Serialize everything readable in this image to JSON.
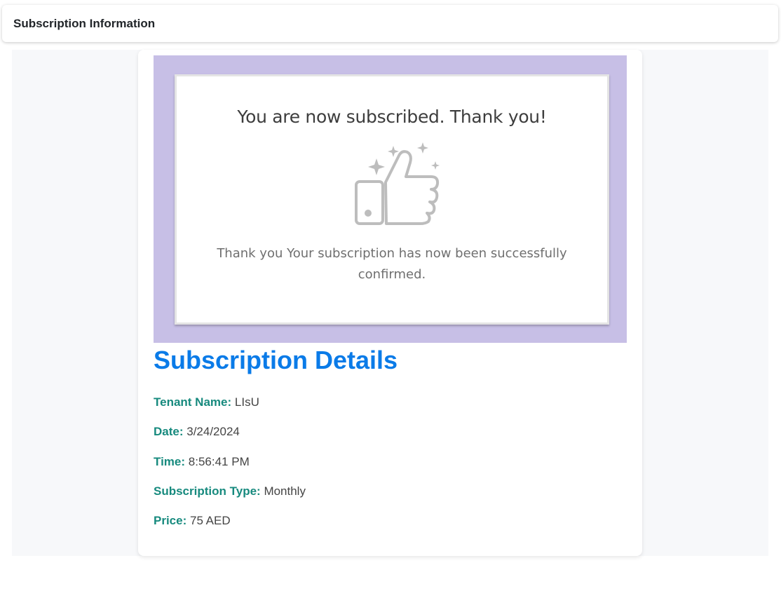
{
  "header": {
    "title": "Subscription Information"
  },
  "banner": {
    "heading": "You are now subscribed. Thank you!",
    "icon": "thumbs-up-sparkles-icon",
    "message": "Thank you Your subscription has now been successfully confirmed.",
    "background_color": "#c7bfe6"
  },
  "details": {
    "title": "Subscription Details",
    "title_color": "#0a7be8",
    "label_color": "#178a7e",
    "rows": [
      {
        "label": "Tenant Name:",
        "value": "LIsU"
      },
      {
        "label": "Date:",
        "value": "3/24/2024"
      },
      {
        "label": "Time:",
        "value": "8:56:41 PM"
      },
      {
        "label": "Subscription Type:",
        "value": "Monthly"
      },
      {
        "label": "Price:",
        "value": "75 AED"
      }
    ]
  }
}
